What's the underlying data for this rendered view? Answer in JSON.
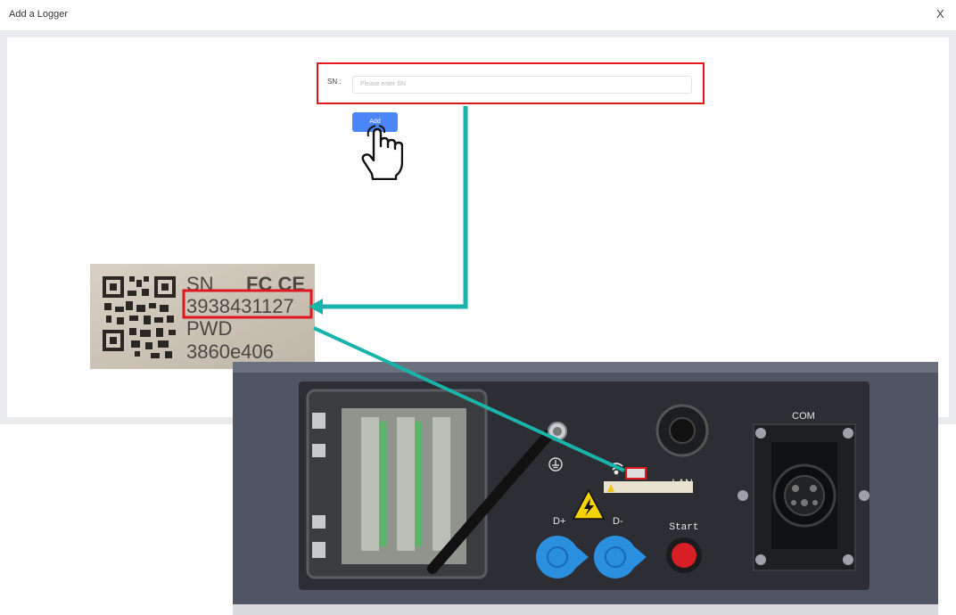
{
  "dialog": {
    "title": "Add a Logger",
    "close_label": "X"
  },
  "form": {
    "sn_label": "SN :",
    "sn_placeholder": "Please enter SN",
    "add_label": "Add"
  },
  "label_photo": {
    "sn_heading": "SN",
    "marks": "FC CE",
    "sn_value": "3938431127",
    "pwd_heading": "PWD",
    "pwd_value": "3860e406"
  },
  "device": {
    "port_lan": "LAN",
    "port_com": "COM",
    "port_dplus": "D+",
    "port_dminus": "D-",
    "start_label": "Start"
  },
  "colors": {
    "highlight": "#e0181d",
    "arrow": "#18b3a9",
    "button": "#4a86f5",
    "port_blue": "#2b8fe0",
    "start_red": "#d81f26"
  },
  "icons": [
    "close-icon",
    "pointing-hand-icon",
    "qr-code-icon",
    "fcc-icon",
    "ce-icon",
    "ground-icon",
    "wifi-icon",
    "high-voltage-warning-icon"
  ]
}
